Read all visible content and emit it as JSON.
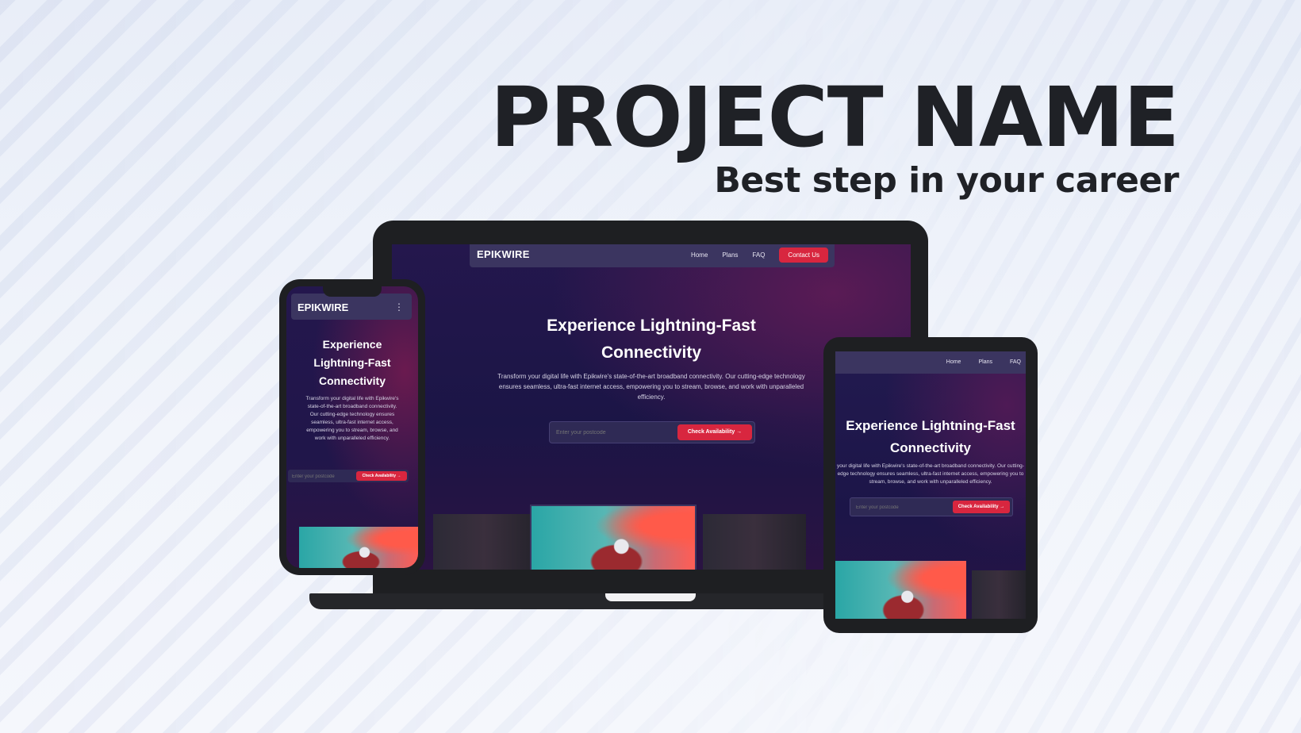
{
  "headline": {
    "title": "PROJECT NAME",
    "subtitle": "Best step in your career"
  },
  "site": {
    "brand": "EPIKWIRE",
    "nav": {
      "home": "Home",
      "plans": "Plans",
      "faq": "FAQ",
      "contact": "Contact Us"
    },
    "hero": {
      "title_line1": "Experience Lightning-Fast",
      "title_line2": "Connectivity",
      "description": "Transform your digital life with Epikwire's state-of-the-art broadband connectivity. Our cutting-edge technology ensures seamless, ultra-fast internet access, empowering you to stream, browse, and work with unparalleled efficiency."
    },
    "search": {
      "placeholder": "Enter your postcode",
      "cta": "Check Availability →"
    }
  },
  "phone": {
    "title_line1": "Experience",
    "title_line2": "Lightning-Fast",
    "title_line3": "Connectivity",
    "description": "Transform your digital life with Epikwire's state-of-the-art broadband connectivity. Our cutting-edge technology ensures seamless, ultra-fast internet access, empowering you to stream, browse, and work with unparalleled efficiency.",
    "menu_icon": "⋮"
  },
  "tablet": {
    "nav": {
      "home": "Home",
      "plans": "Plans",
      "faq": "FAQ"
    },
    "description": "your digital life with Epikwire's state-of-the-art broadband connectivity. Our cutting-edge technology ensures seamless, ultra-fast internet access, empowering you to stream, browse, and work with unparalleled efficiency."
  }
}
